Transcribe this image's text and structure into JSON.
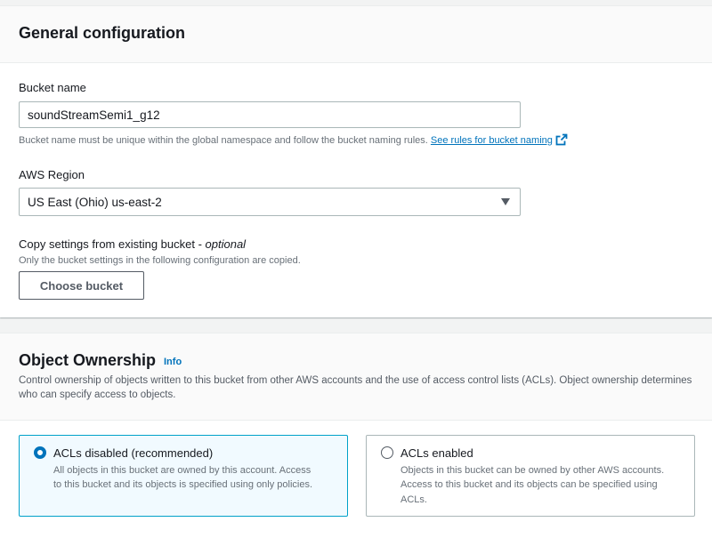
{
  "general": {
    "title": "General configuration",
    "bucket_name": {
      "label": "Bucket name",
      "value": "soundStreamSemi1_g12",
      "hint": "Bucket name must be unique within the global namespace and follow the bucket naming rules.",
      "rules_link": "See rules for bucket naming",
      "rules_link_icon": "external-link-icon"
    },
    "region": {
      "label": "AWS Region",
      "selected": "US East (Ohio) us-east-2",
      "caret_icon": "caret-down-icon"
    },
    "copy_settings": {
      "label": "Copy settings from existing bucket - ",
      "optional": "optional",
      "hint": "Only the bucket settings in the following configuration are copied.",
      "button": "Choose bucket"
    }
  },
  "ownership": {
    "title": "Object Ownership",
    "info": "Info",
    "description": "Control ownership of objects written to this bucket from other AWS accounts and the use of access control lists (ACLs). Object ownership determines who can specify access to objects.",
    "options": [
      {
        "label": "ACLs disabled (recommended)",
        "description": "All objects in this bucket are owned by this account. Access to this bucket and its objects is specified using only policies.",
        "selected": true
      },
      {
        "label": "ACLs enabled",
        "description": "Objects in this bucket can be owned by other AWS accounts. Access to this bucket and its objects can be specified using ACLs.",
        "selected": false
      }
    ]
  },
  "colors": {
    "link": "#0073bb",
    "selected_tile_bg": "#f1faff",
    "selected_tile_border": "#00a1c9",
    "page_bg": "#f2f3f3"
  }
}
